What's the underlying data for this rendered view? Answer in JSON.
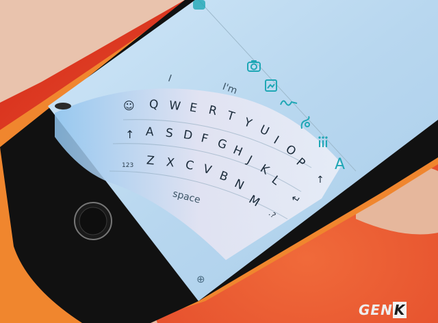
{
  "keyboard": {
    "suggestions": [
      "I",
      "I'm"
    ],
    "rows": [
      [
        "Q",
        "W",
        "E",
        "R",
        "T",
        "Y",
        "U",
        "I",
        "O",
        "P"
      ],
      [
        "A",
        "S",
        "D",
        "F",
        "G",
        "H",
        "J",
        "K",
        "L"
      ],
      [
        "Z",
        "X",
        "C",
        "V",
        "B",
        "N",
        "M"
      ]
    ],
    "space_label": "space",
    "numbers_label": "123",
    "shift_symbol": "↑",
    "shift_symbol_right": "↑",
    "return_symbol": "↵",
    "punct_symbol": ".?",
    "emoji_symbol": "☺",
    "globe_symbol": "⊕",
    "font_symbol": "A"
  },
  "toolbar": {
    "icons": [
      "camera-icon",
      "image-icon",
      "scribble-icon",
      "video-icon",
      "dots-icon",
      "font-icon"
    ]
  },
  "watermark": {
    "part1": "GEN",
    "part2": "K"
  },
  "colors": {
    "background": "#e8432a",
    "screen": "#bcd9ef",
    "accent": "#1fa7b5",
    "phone_body": "#111111"
  }
}
